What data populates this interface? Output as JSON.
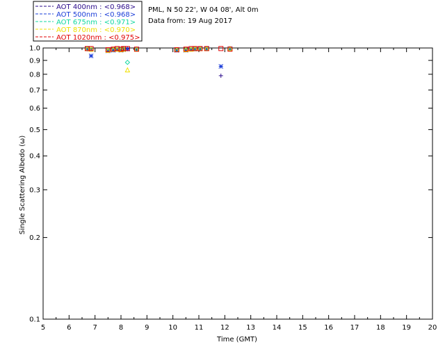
{
  "chart_data": {
    "type": "scatter",
    "xlabel": "Time (GMT)",
    "ylabel": "Single Scattering Albedo (ω)",
    "xlim": [
      5,
      20
    ],
    "ylim": [
      0.1,
      1.0
    ],
    "y_scale": "log",
    "x_ticks": [
      "5",
      "6",
      "7",
      "8",
      "9",
      "10",
      "11",
      "12",
      "13",
      "14",
      "15",
      "16",
      "17",
      "18",
      "19",
      "20"
    ],
    "y_ticks": [
      {
        "value": 1.0,
        "label": "1.0"
      },
      {
        "value": 0.9,
        "label": "0.9"
      },
      {
        "value": 0.8,
        "label": "0.8"
      },
      {
        "value": 0.7,
        "label": "0.7"
      },
      {
        "value": 0.6,
        "label": "0.6"
      },
      {
        "value": 0.5,
        "label": "0.5"
      },
      {
        "value": 0.4,
        "label": "0.4"
      },
      {
        "value": 0.3,
        "label": "0.3"
      },
      {
        "value": 0.2,
        "label": "0.2"
      },
      {
        "value": 0.1,
        "label": "0.1"
      }
    ],
    "info": [
      "PML, N 50 22', W 04 08', Alt 0m",
      "Data from: 19 Aug 2017"
    ],
    "legend_position": "top-left outside",
    "series": [
      {
        "name": "AOT  400nm : <0.968>",
        "color": "#2a0a8a",
        "marker": "plus",
        "points": [
          [
            6.7,
            0.99
          ],
          [
            6.85,
            0.99
          ],
          [
            7.5,
            0.98
          ],
          [
            7.7,
            0.985
          ],
          [
            7.85,
            0.99
          ],
          [
            8.0,
            0.985
          ],
          [
            8.1,
            0.99
          ],
          [
            8.25,
            0.995
          ],
          [
            8.6,
            0.99
          ],
          [
            10.15,
            0.985
          ],
          [
            10.5,
            0.985
          ],
          [
            10.7,
            0.99
          ],
          [
            10.85,
            0.995
          ],
          [
            11.05,
            0.995
          ],
          [
            11.3,
            0.995
          ],
          [
            11.85,
            0.79
          ],
          [
            12.2,
            0.995
          ]
        ]
      },
      {
        "name": "AOT  500nm : <0.968>",
        "color": "#1a3cd8",
        "marker": "asterisk",
        "points": [
          [
            6.7,
            0.995
          ],
          [
            6.85,
            0.935
          ],
          [
            7.5,
            0.975
          ],
          [
            7.7,
            0.98
          ],
          [
            7.85,
            0.99
          ],
          [
            8.0,
            0.98
          ],
          [
            8.1,
            0.985
          ],
          [
            8.25,
            0.99
          ],
          [
            8.6,
            0.99
          ],
          [
            10.15,
            0.98
          ],
          [
            10.5,
            0.98
          ],
          [
            10.7,
            0.99
          ],
          [
            10.85,
            0.99
          ],
          [
            11.05,
            0.995
          ],
          [
            11.3,
            0.995
          ],
          [
            11.85,
            0.855
          ],
          [
            12.2,
            0.995
          ]
        ]
      },
      {
        "name": "AOT  675nm : <0.971>",
        "color": "#10d8a0",
        "marker": "diamond",
        "points": [
          [
            6.7,
            0.995
          ],
          [
            6.85,
            0.99
          ],
          [
            7.5,
            0.98
          ],
          [
            7.7,
            0.985
          ],
          [
            7.85,
            0.99
          ],
          [
            8.0,
            0.99
          ],
          [
            8.1,
            0.995
          ],
          [
            8.25,
            0.885
          ],
          [
            8.6,
            0.99
          ],
          [
            10.15,
            0.985
          ],
          [
            10.5,
            0.985
          ],
          [
            10.7,
            0.99
          ],
          [
            10.85,
            0.995
          ],
          [
            11.05,
            0.995
          ],
          [
            11.3,
            0.995
          ],
          [
            12.2,
            0.995
          ]
        ]
      },
      {
        "name": "AOT  870nm : <0.970>",
        "color": "#f0e000",
        "marker": "triangle",
        "points": [
          [
            6.7,
            0.995
          ],
          [
            6.85,
            0.99
          ],
          [
            7.5,
            0.98
          ],
          [
            7.7,
            0.99
          ],
          [
            7.85,
            0.99
          ],
          [
            8.0,
            0.985
          ],
          [
            8.1,
            0.99
          ],
          [
            8.25,
            0.83
          ],
          [
            8.6,
            0.99
          ],
          [
            10.15,
            0.985
          ],
          [
            10.5,
            0.985
          ],
          [
            10.7,
            0.99
          ],
          [
            10.85,
            0.995
          ],
          [
            11.05,
            0.995
          ],
          [
            11.3,
            0.995
          ],
          [
            12.2,
            0.995
          ]
        ]
      },
      {
        "name": "AOT 1020nm : <0.975>",
        "color": "#e00000",
        "marker": "square",
        "points": [
          [
            6.7,
            0.995
          ],
          [
            6.85,
            0.995
          ],
          [
            7.5,
            0.985
          ],
          [
            7.7,
            0.99
          ],
          [
            7.85,
            0.995
          ],
          [
            8.0,
            0.99
          ],
          [
            8.1,
            0.995
          ],
          [
            8.25,
            0.995
          ],
          [
            8.6,
            0.99
          ],
          [
            10.15,
            0.985
          ],
          [
            10.5,
            0.99
          ],
          [
            10.7,
            0.995
          ],
          [
            10.85,
            0.995
          ],
          [
            11.05,
            0.995
          ],
          [
            11.3,
            0.995
          ],
          [
            11.85,
            0.995
          ],
          [
            12.2,
            0.99
          ]
        ]
      }
    ]
  }
}
